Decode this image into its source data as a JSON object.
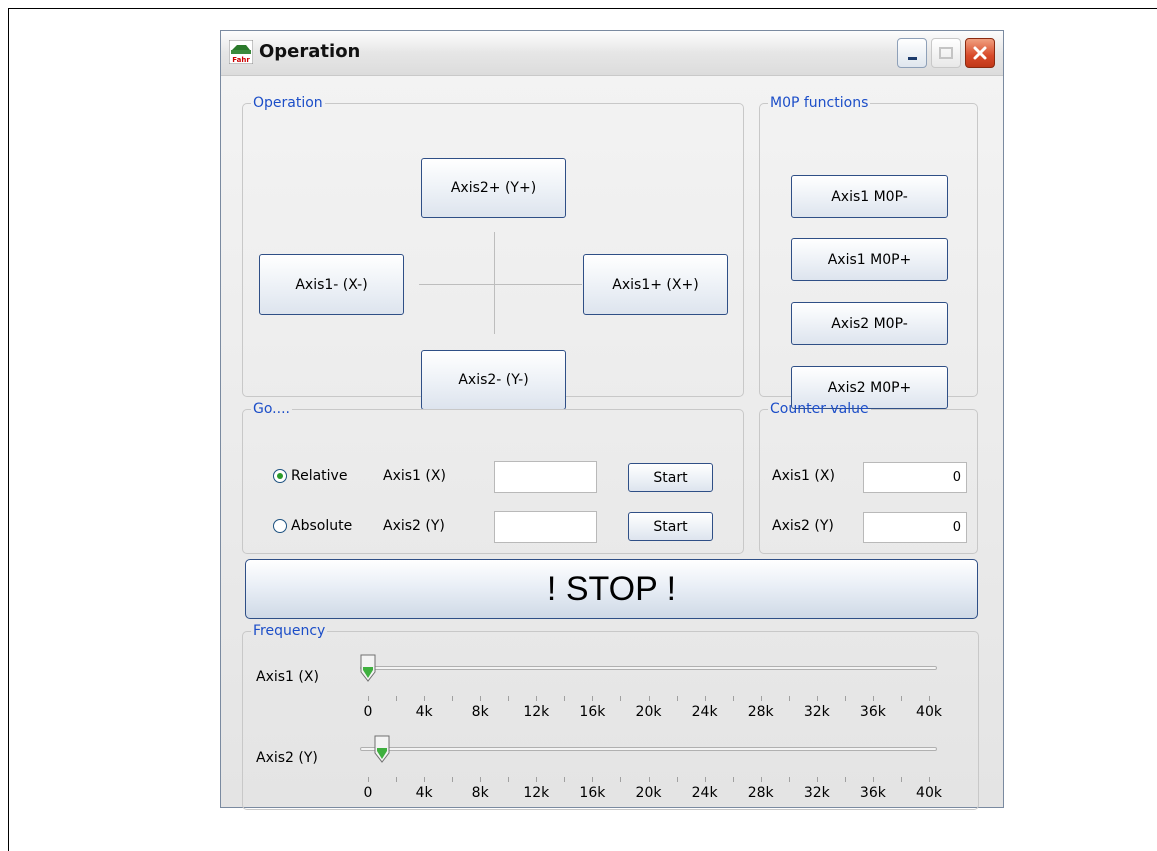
{
  "window": {
    "title": "Operation",
    "icon_text": "Fahr"
  },
  "operation_group": {
    "legend": "Operation",
    "axis2_plus": "Axis2+ (Y+)",
    "axis1_minus": "Axis1- (X-)",
    "axis1_plus": "Axis1+ (X+)",
    "axis2_minus": "Axis2- (Y-)"
  },
  "mop_group": {
    "legend": "M0P functions",
    "buttons": [
      "Axis1 M0P-",
      "Axis1 M0P+",
      "Axis2 M0P-",
      "Axis2 M0P+"
    ]
  },
  "go_group": {
    "legend": "Go....",
    "relative_label": "Relative",
    "absolute_label": "Absolute",
    "selected": "Relative",
    "axis1_label": "Axis1 (X)",
    "axis2_label": "Axis2 (Y)",
    "axis1_value": "",
    "axis2_value": "",
    "start_label": "Start"
  },
  "counter_group": {
    "legend": "Counter value",
    "axis1_label": "Axis1 (X)",
    "axis2_label": "Axis2 (Y)",
    "axis1_value": "0",
    "axis2_value": "0"
  },
  "stop_label": "! STOP !",
  "frequency_group": {
    "legend": "Frequency",
    "axis1_label": "Axis1 (X)",
    "axis2_label": "Axis2 (Y)",
    "tick_labels": [
      "0",
      "4k",
      "8k",
      "12k",
      "16k",
      "20k",
      "24k",
      "28k",
      "32k",
      "36k",
      "40k"
    ],
    "axis1_value": 0,
    "axis2_value": 1000,
    "range": [
      0,
      40000
    ]
  },
  "colors": {
    "accent": "#1c4ec8",
    "button_border": "#2f4f86"
  }
}
